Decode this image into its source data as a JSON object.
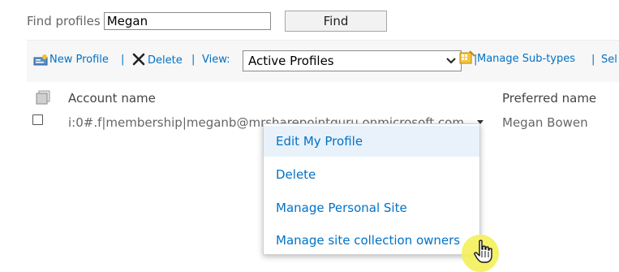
{
  "find": {
    "label": "Find profiles",
    "input_value": "Megan",
    "button_label": "Find"
  },
  "toolbar": {
    "new_profile": "New Profile",
    "separator": "|",
    "delete": "Delete",
    "view_label": "View:",
    "view_value": "Active Profiles",
    "manage_subtypes": "Manage Sub-types",
    "select_truncated": "Sel"
  },
  "table": {
    "headers": {
      "account": "Account name",
      "preferred": "Preferred name"
    },
    "rows": [
      {
        "account": "i:0#.f|membership|meganb@mrsharepointguru.onmicrosoft.com",
        "preferred": "Megan Bowen"
      }
    ]
  },
  "context_menu": {
    "items": [
      {
        "label": "Edit My Profile",
        "highlighted": true
      },
      {
        "label": "Delete",
        "highlighted": false
      },
      {
        "label": "Manage Personal Site",
        "highlighted": false
      },
      {
        "label": "Manage site collection owners",
        "highlighted": false
      }
    ]
  },
  "icons": {
    "new_profile": "new-profile-icon",
    "delete": "delete-x-icon",
    "manage_subtypes": "manage-subtypes-icon",
    "select_all": "select-all-icon",
    "dropdown": "chevron-down-icon",
    "pointer": "hand-pointer-icon"
  },
  "colors": {
    "link": "#0072c6",
    "toolbar_bg": "#f7f7f7",
    "menu_highlight": "#e9f2fb",
    "cursor_highlight": "#f4f05a"
  }
}
